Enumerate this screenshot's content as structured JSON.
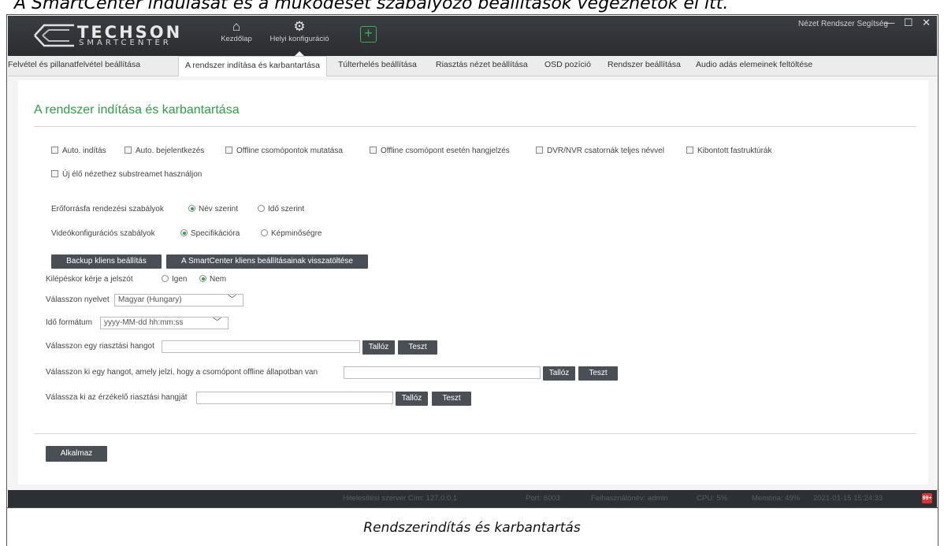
{
  "document": {
    "top_text": "A SmartCenter indulását és a működését szabályozó beállítások végezhetők el itt.",
    "caption": "Rendszerindítás és karbantartás"
  },
  "header": {
    "logo_main": "TECHSON",
    "logo_sub": "SMARTCENTER",
    "nav": [
      {
        "label": "Kezdőlap",
        "icon": "home-icon"
      },
      {
        "label": "Helyi konfiguráció",
        "icon": "gear-icon"
      }
    ],
    "add_icon": "plus-icon",
    "window_menu": "Nézet Rendszer Segítség",
    "window_controls": [
      "minimize-icon",
      "maximize-icon",
      "close-icon"
    ]
  },
  "tabs": [
    "Felvétel és pillanatfelvétel beállítása",
    "A rendszer indítása és karbantartása",
    "Túlterhelés beállítása",
    "Riasztás nézet beállítása",
    "OSD pozíció",
    "Rendszer beállítása",
    "Audio adás elemeinek feltöltése"
  ],
  "active_tab_index": 1,
  "section_title": "A rendszer indítása és karbantartása",
  "checkboxes": [
    {
      "label": "Auto. indítás",
      "checked": false
    },
    {
      "label": "Auto. bejelentkezés",
      "checked": false
    },
    {
      "label": "Offline csomópontok mutatása",
      "checked": false
    },
    {
      "label": "Offline csomópont esetén hangjelzés",
      "checked": false
    },
    {
      "label": "DVR/NVR csatornák teljes névvel",
      "checked": false
    },
    {
      "label": "Kibontott fastruktúrák",
      "checked": false
    },
    {
      "label": "Új élő nézethez substreamet használjon",
      "checked": false
    }
  ],
  "resource_sort": {
    "label": "Erőforrásfa rendezési szabályok",
    "options": [
      {
        "label": "Név szerint",
        "selected": true
      },
      {
        "label": "Idő szerint",
        "selected": false
      }
    ]
  },
  "video_config": {
    "label": "Videókonfigurációs szabályok",
    "options": [
      {
        "label": "Specifikációra",
        "selected": true
      },
      {
        "label": "Képminőségre",
        "selected": false
      }
    ]
  },
  "backup_button": "Backup kliens beállítás",
  "restore_button": "A SmartCenter kliens beállításainak visszatöltése",
  "exit_password": {
    "label": "Kilépéskor kérje a jelszót",
    "options": [
      {
        "label": "Igen",
        "selected": false
      },
      {
        "label": "Nem",
        "selected": true
      }
    ]
  },
  "language": {
    "label": "Válasszon nyelvet",
    "value": "Magyar (Hungary)"
  },
  "time_format": {
    "label": "Idő formátum",
    "value": "yyyy-MM-dd hh:mm:ss"
  },
  "sounds": [
    {
      "label": "Válasszon egy riasztási hangot",
      "value": "",
      "browse": "Tallóz",
      "test": "Teszt"
    },
    {
      "label": "Válasszon ki egy hangot, amely jelzi, hogy a csomópont offline állapotban van",
      "value": "",
      "browse": "Tallóz",
      "test": "Teszt"
    },
    {
      "label": "Válassza ki az érzékelő riasztási hangját",
      "value": "",
      "browse": "Tallóz",
      "test": "Teszt"
    }
  ],
  "apply_button": "Alkalmaz",
  "status_bar": {
    "server": "Hitelesítési szerver Cím: 127.0.0.1",
    "port": "Port: 6003",
    "user": "Felhasználónév: admin",
    "cpu": "CPU: 5%",
    "memory": "Memória: 49%",
    "datetime": "2021-01-15 15:24:33",
    "alarm_badge": "99+"
  },
  "colors": {
    "accent": "#2f9e44",
    "header_bg": "#2e3034",
    "button_bg": "#4a4f56",
    "alarm": "#e03131"
  }
}
